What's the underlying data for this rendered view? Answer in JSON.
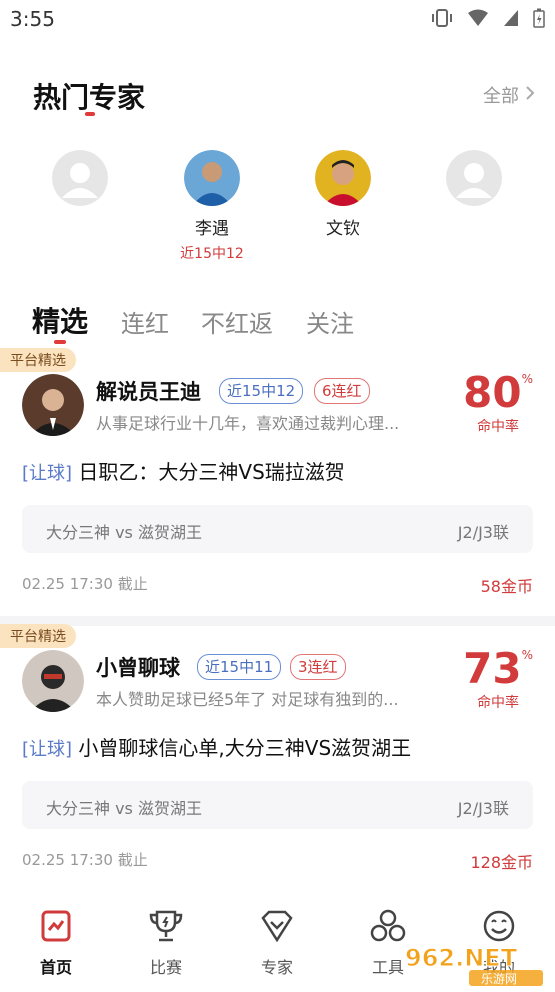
{
  "status_bar": {
    "time": "3:55"
  },
  "hot_experts": {
    "title": "热门专家",
    "view_all": "全部",
    "experts": [
      {
        "name": "",
        "stat": ""
      },
      {
        "name": "李遇",
        "stat": "近15中12"
      },
      {
        "name": "文钦",
        "stat": ""
      },
      {
        "name": "",
        "stat": ""
      }
    ]
  },
  "tabs": [
    "精选",
    "连红",
    "不红返",
    "关注"
  ],
  "cards": [
    {
      "badge": "平台精选",
      "name": "解说员王迪",
      "tag_record": "近15中12",
      "tag_streak": "6连红",
      "desc": "从事足球行业十几年，喜欢通过裁判心理...",
      "rate_num": "80",
      "rate_pct": "%",
      "rate_label": "命中率",
      "bracket": "[让球]",
      "headline": " 日职乙：大分三神VS瑞拉滋贺",
      "match_teams": "大分三神 vs 滋贺湖王",
      "match_league": "J2/J3联",
      "deadline": "02.25 17:30 截止",
      "price": "58金币"
    },
    {
      "badge": "平台精选",
      "name": "小曾聊球",
      "tag_record": "近15中11",
      "tag_streak": "3连红",
      "desc": "本人赞助足球已经5年了 对足球有独到的...",
      "rate_num": "73",
      "rate_pct": "%",
      "rate_label": "命中率",
      "bracket": "[让球]",
      "headline": " 小曾聊球信心单,大分三神VS滋贺湖王",
      "match_teams": "大分三神 vs 滋贺湖王",
      "match_league": "J2/J3联",
      "deadline": "02.25 17:30 截止",
      "price": "128金币"
    }
  ],
  "bottom_nav": [
    {
      "label": "首页",
      "icon": "home-chart-icon",
      "active": true
    },
    {
      "label": "比赛",
      "icon": "trophy-icon",
      "active": false
    },
    {
      "label": "专家",
      "icon": "diamond-badge-icon",
      "active": false
    },
    {
      "label": "工具",
      "icon": "tools-circles-icon",
      "active": false
    },
    {
      "label": "我的",
      "icon": "smiley-icon",
      "active": false
    }
  ],
  "watermark": {
    "text": "962.NET",
    "sub": "乐游网"
  },
  "colors": {
    "accent": "#d23b3b",
    "tag_blue": "#4b6fc0",
    "badge_bg": "#fbe3bf"
  }
}
